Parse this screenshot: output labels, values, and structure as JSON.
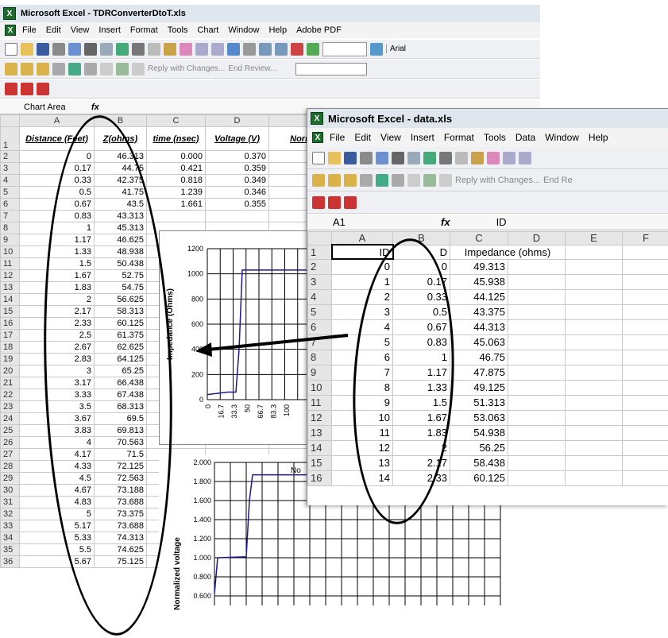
{
  "win1": {
    "title": "Microsoft Excel - TDRConverterDtoT.xls",
    "menu": [
      "File",
      "Edit",
      "View",
      "Insert",
      "Format",
      "Tools",
      "Chart",
      "Window",
      "Help",
      "Adobe PDF"
    ],
    "font_box": "Arial",
    "toolbar2_items": [
      "Reply with Changes...",
      "End Review..."
    ],
    "name_box": "Chart Area",
    "fx": "fx",
    "col_headers": [
      "A",
      "B",
      "C",
      "D"
    ],
    "headers": [
      "Distance (Feet)",
      "Z(ohms)",
      "time (nsec)",
      "Voltage (V)",
      "Norm"
    ],
    "rows": [
      {
        "r": "2",
        "a": "0",
        "b": "46.313",
        "c": "0.000",
        "d": "0.370"
      },
      {
        "r": "3",
        "a": "0.17",
        "b": "44.75",
        "c": "0.421",
        "d": "0.359"
      },
      {
        "r": "4",
        "a": "0.33",
        "b": "42.375",
        "c": "0.818",
        "d": "0.349"
      },
      {
        "r": "5",
        "a": "0.5",
        "b": "41.75",
        "c": "1.239",
        "d": "0.346"
      },
      {
        "r": "6",
        "a": "0.67",
        "b": "43.5",
        "c": "1.661",
        "d": "0.355"
      },
      {
        "r": "7",
        "a": "0.83",
        "b": "43.313",
        "c": "",
        "d": ""
      },
      {
        "r": "8",
        "a": "1",
        "b": "45.313",
        "c": "",
        "d": ""
      },
      {
        "r": "9",
        "a": "1.17",
        "b": "46.625",
        "c": "",
        "d": ""
      },
      {
        "r": "10",
        "a": "1.33",
        "b": "48.938",
        "c": "",
        "d": ""
      },
      {
        "r": "11",
        "a": "1.5",
        "b": "50.438",
        "c": "",
        "d": ""
      },
      {
        "r": "12",
        "a": "1.67",
        "b": "52.75",
        "c": "",
        "d": ""
      },
      {
        "r": "13",
        "a": "1.83",
        "b": "54.75",
        "c": "",
        "d": ""
      },
      {
        "r": "14",
        "a": "2",
        "b": "56.625",
        "c": "",
        "d": ""
      },
      {
        "r": "15",
        "a": "2.17",
        "b": "58.313",
        "c": "",
        "d": ""
      },
      {
        "r": "16",
        "a": "2.33",
        "b": "60.125",
        "c": "",
        "d": ""
      },
      {
        "r": "17",
        "a": "2.5",
        "b": "61.375",
        "c": "",
        "d": ""
      },
      {
        "r": "18",
        "a": "2.67",
        "b": "62.625",
        "c": "",
        "d": ""
      },
      {
        "r": "19",
        "a": "2.83",
        "b": "64.125",
        "c": "",
        "d": ""
      },
      {
        "r": "20",
        "a": "3",
        "b": "65.25",
        "c": "",
        "d": ""
      },
      {
        "r": "21",
        "a": "3.17",
        "b": "66.438",
        "c": "",
        "d": ""
      },
      {
        "r": "22",
        "a": "3.33",
        "b": "67.438",
        "c": "",
        "d": ""
      },
      {
        "r": "23",
        "a": "3.5",
        "b": "68.313",
        "c": "",
        "d": ""
      },
      {
        "r": "24",
        "a": "3.67",
        "b": "69.5",
        "c": "",
        "d": ""
      },
      {
        "r": "25",
        "a": "3.83",
        "b": "69.813",
        "c": "",
        "d": ""
      },
      {
        "r": "26",
        "a": "4",
        "b": "70.563",
        "c": "",
        "d": ""
      },
      {
        "r": "27",
        "a": "4.17",
        "b": "71.5",
        "c": "",
        "d": ""
      },
      {
        "r": "28",
        "a": "4.33",
        "b": "72.125",
        "c": "",
        "d": ""
      },
      {
        "r": "29",
        "a": "4.5",
        "b": "72.563",
        "c": "",
        "d": ""
      },
      {
        "r": "30",
        "a": "4.67",
        "b": "73.188",
        "c": "",
        "d": ""
      },
      {
        "r": "31",
        "a": "4.83",
        "b": "73.688",
        "c": "",
        "d": ""
      },
      {
        "r": "32",
        "a": "5",
        "b": "73.375",
        "c": "",
        "d": ""
      },
      {
        "r": "33",
        "a": "5.17",
        "b": "73.688",
        "c": "",
        "d": ""
      },
      {
        "r": "34",
        "a": "5.33",
        "b": "74.313",
        "c": "",
        "d": ""
      },
      {
        "r": "35",
        "a": "5.5",
        "b": "74.625",
        "c": "",
        "d": ""
      },
      {
        "r": "36",
        "a": "5.67",
        "b": "75.125",
        "c": "",
        "d": ""
      }
    ],
    "chart1": {
      "ylabel": "Impedance (Ohms)",
      "yticks": [
        "1200",
        "1000",
        "800",
        "600",
        "400",
        "200",
        "0"
      ],
      "xticks": [
        "0",
        "16.7",
        "33.3",
        "50",
        "66.7",
        "83.3",
        "100"
      ]
    },
    "chart2": {
      "ylabel": "Normalized voltage",
      "yticks": [
        "2.000",
        "1.800",
        "1.600",
        "1.400",
        "1.200",
        "1.000",
        "0.800",
        "0.600"
      ]
    },
    "stub_no": "No"
  },
  "win2": {
    "title": "Microsoft Excel - data.xls",
    "menu": [
      "File",
      "Edit",
      "View",
      "Insert",
      "Format",
      "Tools",
      "Data",
      "Window",
      "Help"
    ],
    "toolbar2_items": [
      "Reply with Changes...",
      "End Re"
    ],
    "name_box": "A1",
    "fx": "fx",
    "formula": "ID",
    "col_headers": [
      "A",
      "B",
      "C",
      "D",
      "E",
      "F"
    ],
    "row1": {
      "a": "ID",
      "b": "D",
      "c": "Impedance (ohms)"
    },
    "rows": [
      {
        "r": "2",
        "a": "0",
        "b": "0",
        "c": "49.313"
      },
      {
        "r": "3",
        "a": "1",
        "b": "0.17",
        "c": "45.938"
      },
      {
        "r": "4",
        "a": "2",
        "b": "0.33",
        "c": "44.125"
      },
      {
        "r": "5",
        "a": "3",
        "b": "0.5",
        "c": "43.375"
      },
      {
        "r": "6",
        "a": "4",
        "b": "0.67",
        "c": "44.313"
      },
      {
        "r": "7",
        "a": "5",
        "b": "0.83",
        "c": "45.063"
      },
      {
        "r": "8",
        "a": "6",
        "b": "1",
        "c": "46.75"
      },
      {
        "r": "9",
        "a": "7",
        "b": "1.17",
        "c": "47.875"
      },
      {
        "r": "10",
        "a": "8",
        "b": "1.33",
        "c": "49.125"
      },
      {
        "r": "11",
        "a": "9",
        "b": "1.5",
        "c": "51.313"
      },
      {
        "r": "12",
        "a": "10",
        "b": "1.67",
        "c": "53.063"
      },
      {
        "r": "13",
        "a": "11",
        "b": "1.83",
        "c": "54.938"
      },
      {
        "r": "14",
        "a": "12",
        "b": "2",
        "c": "56.25"
      },
      {
        "r": "15",
        "a": "13",
        "b": "2.17",
        "c": "58.438"
      },
      {
        "r": "16",
        "a": "14",
        "b": "2.33",
        "c": "60.125"
      }
    ]
  }
}
